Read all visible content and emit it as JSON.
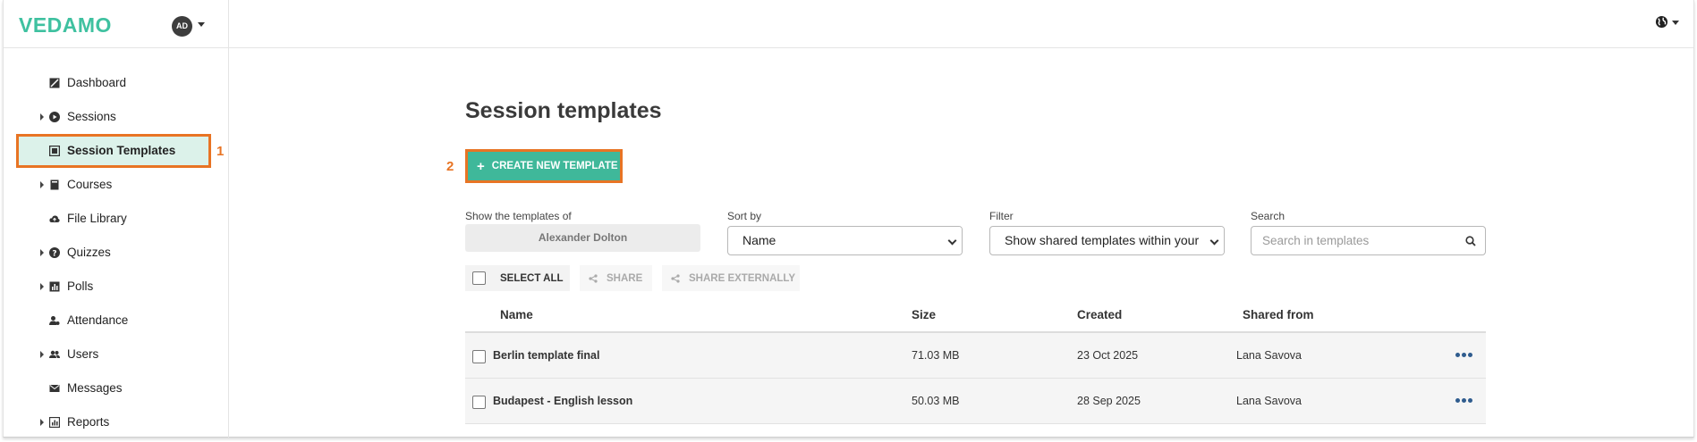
{
  "app": {
    "logo": "VEDAMO",
    "avatar_initials": "AD",
    "brand_color": "#3fc1a0",
    "highlight_color": "#e87424"
  },
  "sidebar": {
    "items": [
      {
        "label": "Dashboard",
        "icon": "dashboard-icon",
        "expandable": false
      },
      {
        "label": "Sessions",
        "icon": "play-circle-icon",
        "expandable": true
      },
      {
        "label": "Session Templates",
        "icon": "template-icon",
        "expandable": false,
        "active": true
      },
      {
        "label": "Courses",
        "icon": "book-icon",
        "expandable": true
      },
      {
        "label": "File Library",
        "icon": "cloud-icon",
        "expandable": false
      },
      {
        "label": "Quizzes",
        "icon": "question-circle-icon",
        "expandable": true
      },
      {
        "label": "Polls",
        "icon": "bar-chart-icon",
        "expandable": true
      },
      {
        "label": "Attendance",
        "icon": "user-check-icon",
        "expandable": false
      },
      {
        "label": "Users",
        "icon": "users-icon",
        "expandable": true
      },
      {
        "label": "Messages",
        "icon": "envelope-icon",
        "expandable": false
      },
      {
        "label": "Reports",
        "icon": "report-icon",
        "expandable": true
      }
    ]
  },
  "annotations": {
    "one": "1",
    "two": "2"
  },
  "main": {
    "title": "Session templates",
    "create_button": "CREATE NEW TEMPLATE",
    "filters": {
      "owner_label": "Show the templates of",
      "owner_value": "Alexander Dolton",
      "sort_label": "Sort by",
      "sort_value": "Name",
      "filter_label": "Filter",
      "filter_value": "Show shared templates within your",
      "search_label": "Search",
      "search_placeholder": "Search in templates"
    },
    "toolbar": {
      "select_all": "SELECT ALL",
      "share": "SHARE",
      "share_externally": "SHARE EXTERNALLY"
    },
    "table": {
      "headers": {
        "name": "Name",
        "size": "Size",
        "created": "Created",
        "shared_from": "Shared from"
      },
      "rows": [
        {
          "name": "Berlin template final",
          "size": "71.03 MB",
          "created": "23 Oct 2025",
          "shared_from": "Lana Savova"
        },
        {
          "name": "Budapest - English lesson",
          "size": "50.03 MB",
          "created": "28 Sep 2025",
          "shared_from": "Lana Savova"
        }
      ]
    }
  }
}
